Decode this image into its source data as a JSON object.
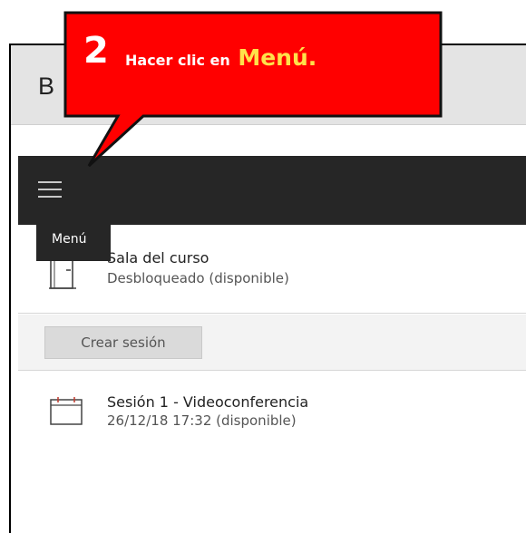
{
  "header": {
    "title": "B"
  },
  "toolbar": {
    "menu_tooltip": "Menú",
    "menu_icon": "hamburger-menu-icon"
  },
  "room": {
    "title": "Sala del curso",
    "status": "Desbloqueado (disponible)",
    "icon": "door-icon"
  },
  "actions": {
    "create_session_label": "Crear sesión"
  },
  "sessions": [
    {
      "title": "Sesión 1 - Videoconferencia",
      "status": "26/12/18 17:32 (disponible)",
      "icon": "calendar-icon"
    }
  ],
  "callout": {
    "step_number": "2",
    "text": "Hacer clic en",
    "highlight": "Menú.",
    "fill_color": "#ff0000",
    "highlight_color": "#ffe14a"
  },
  "colors": {
    "dark_bar": "#262626",
    "title_bar": "#e4e4e4",
    "create_row": "#f3f3f3"
  }
}
